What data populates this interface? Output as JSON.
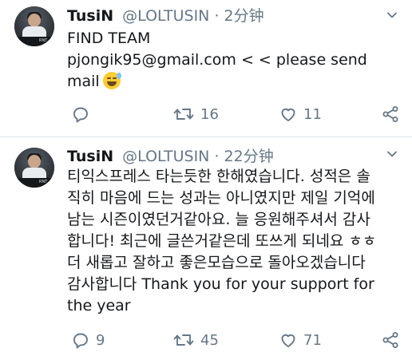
{
  "tweets": [
    {
      "name": "TusiN",
      "handle": "@LOLTUSIN",
      "separator": "·",
      "time": "2分钟",
      "body_lines": [
        "FIND TEAM",
        "pjongik95@gmail.com < <  please send",
        "mail"
      ],
      "emoji": "sweat-smile",
      "reply_count": "",
      "retweet_count": "16",
      "like_count": "11"
    },
    {
      "name": "TusiN",
      "handle": "@LOLTUSIN",
      "separator": "·",
      "time": "22分钟",
      "body_lines": [
        "티익스프레스 타는듯한 한해였습니다. 성적은 솔",
        "직히 마음에 드는 성과는 아니였지만 제일 기억에",
        "남는 시즌이였던거같아요. 늘 응원해주셔서 감사",
        "합니다! 최근에 글쓴거같은데 또쓰게 되네요 ㅎㅎ",
        "더 새롭고 잘하고 좋은모습으로 돌아오겠습니다",
        "감사합니다 Thank you for your support for",
        "the year"
      ],
      "reply_count": "9",
      "retweet_count": "45",
      "like_count": "71"
    }
  ],
  "icons": {
    "reply": "reply-icon",
    "retweet": "retweet-icon",
    "like": "like-icon",
    "share": "share-icon",
    "menu": "chevron-down-icon"
  },
  "colors": {
    "text": "#14171a",
    "secondary": "#657786",
    "divider": "#e1e8ed"
  }
}
